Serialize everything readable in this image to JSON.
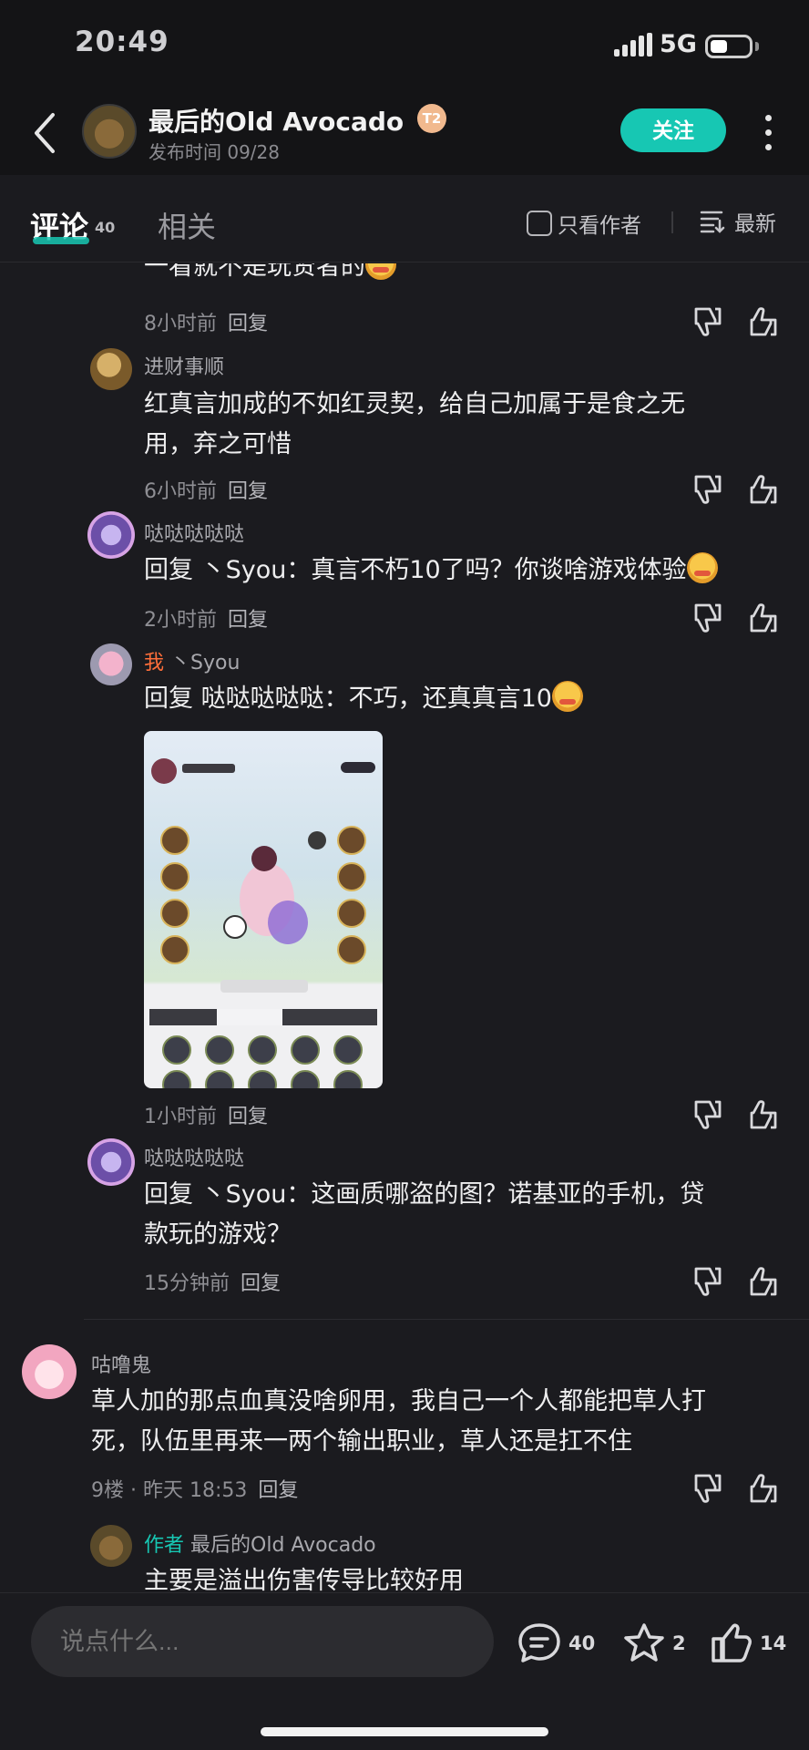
{
  "status_bar": {
    "time": "20:49",
    "network": "5G"
  },
  "header": {
    "author_name": "最后的Old  Avocado",
    "level_badge": "T2",
    "post_time": "发布时间 09/28",
    "follow_label": "关注"
  },
  "tabs": {
    "comments_label": "评论",
    "comments_count": "40",
    "related_label": "相关",
    "only_author_label": "只看作者",
    "sort_label": "最新"
  },
  "comments": {
    "c0": {
      "text": "一看就不是玩贤者的",
      "time": "8小时前",
      "reply": "回复"
    },
    "c1": {
      "user": "进财事顺",
      "line1": "红真言加成的不如红灵契，给自己加属于是食之无",
      "line2": "用，弃之可惜",
      "time": "6小时前",
      "reply": "回复"
    },
    "c2": {
      "user": "哒哒哒哒哒",
      "text": "回复 丶Syou：真言不朽10了吗？你谈啥游戏体验",
      "time": "2小时前",
      "reply": "回复"
    },
    "c3": {
      "me_tag": "我",
      "user": " 丶Syou",
      "text": "回复 哒哒哒哒哒：不巧，还真真言10",
      "time": "1小时前",
      "reply": "回复"
    },
    "c4": {
      "user": "哒哒哒哒哒",
      "line1": "回复 丶Syou：这画质哪盗的图？诺基亚的手机，贷",
      "line2": "款玩的游戏？",
      "time": "15分钟前",
      "reply": "回复"
    },
    "c5": {
      "user": "咕噜鬼",
      "line1": "草人加的那点血真没啥卵用，我自己一个人都能把草人打",
      "line2": "死，队伍里再来一两个输出职业，草人还是扛不住",
      "floor": "9楼 · 昨天 18:53",
      "reply": "回复"
    },
    "c6": {
      "author_tag": "作者",
      "user": " 最后的Old  Avocado",
      "text": "主要是溢出伤害传导比较好用"
    }
  },
  "bottom_bar": {
    "input_placeholder": "说点什么...",
    "comment_count": "40",
    "star_count": "2",
    "like_count": "14"
  },
  "colors": {
    "accent": "#17c7b3",
    "me_tag": "#ff6e3a",
    "background": "#1b1b1f"
  }
}
